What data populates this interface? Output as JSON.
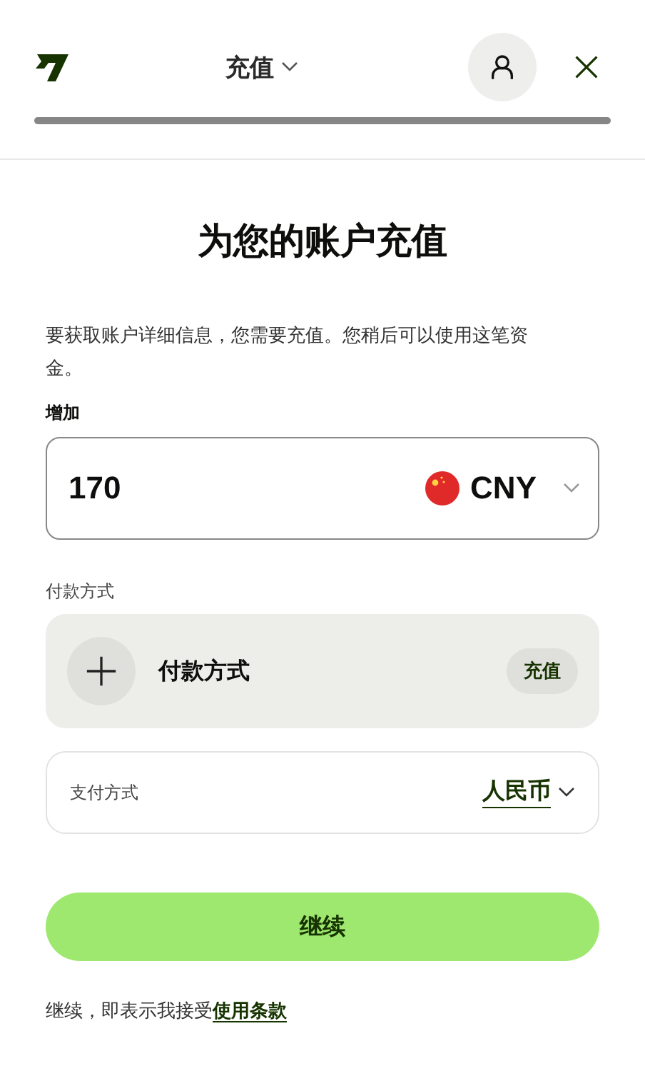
{
  "header": {
    "title": "充值",
    "progress": {
      "level": 1
    }
  },
  "heading": "为您的账户充值",
  "description": "要获取账户详细信息，您需要充值。您稍后可以使用这笔资金。",
  "amount": {
    "label": "增加",
    "value": "170",
    "currency": "CNY"
  },
  "payment": {
    "label": "付款方式",
    "method": "付款方式",
    "badge": "充值"
  },
  "pay_with": {
    "label": "支付方式",
    "value": "人民币"
  },
  "continue_button": "继续",
  "terms": {
    "text": "继续，即表示我接受",
    "link": "使用条款"
  }
}
